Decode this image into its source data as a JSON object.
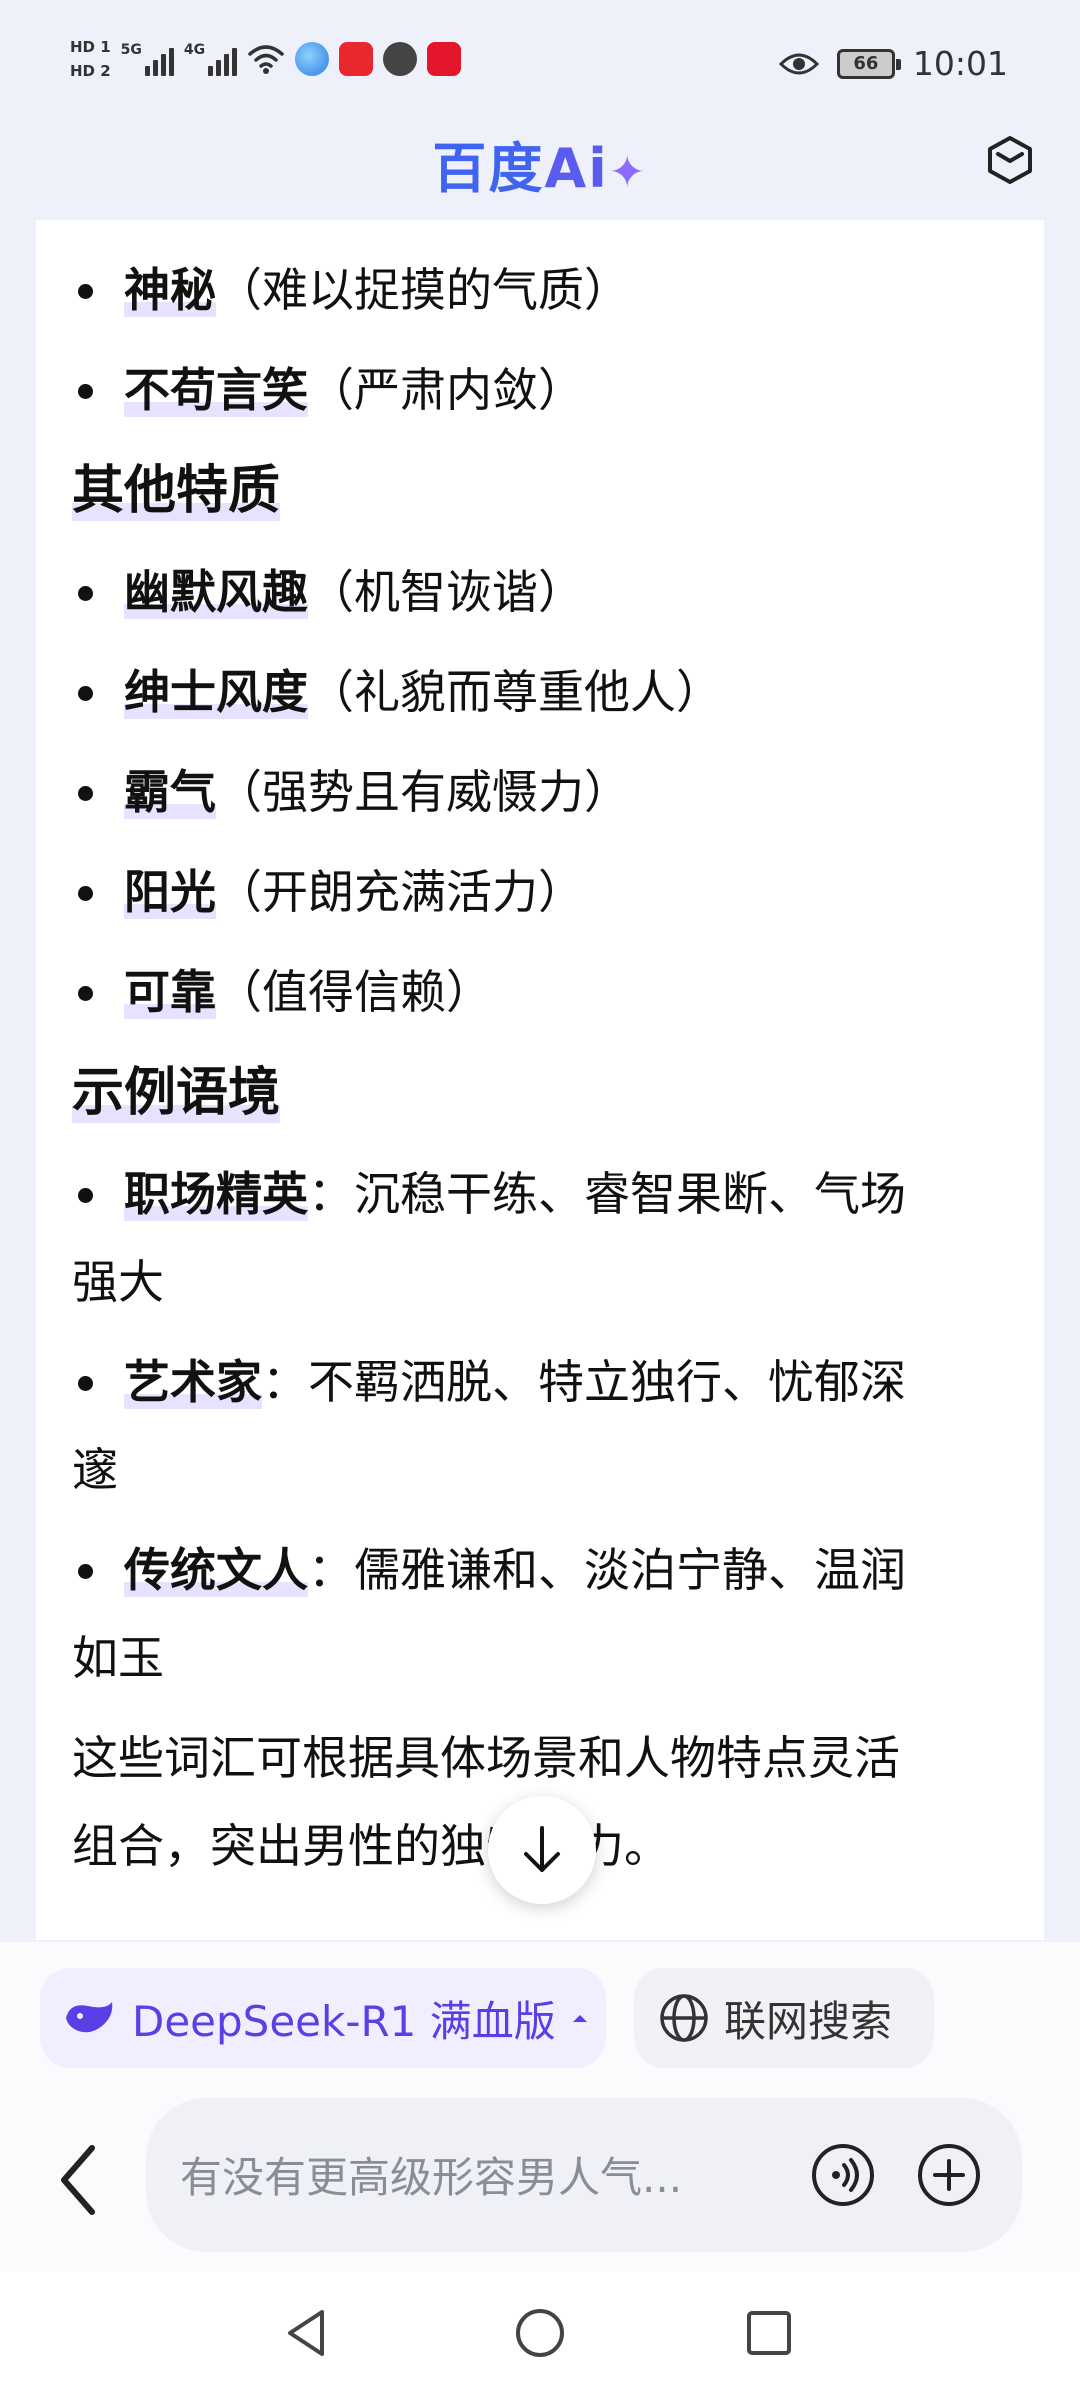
{
  "status_bar": {
    "hd1": "HD 1",
    "hd2": "HD 2",
    "net1": "5G",
    "net2": "4G",
    "battery": "66",
    "time": "10:01"
  },
  "header": {
    "logo_main": "百度",
    "logo_ai": "Ai",
    "logo_spark": "✦"
  },
  "content": {
    "items_top": [
      {
        "keyword": "神秘",
        "desc": "（难以捉摸的气质）"
      },
      {
        "keyword": "不苟言笑",
        "desc": "（严肃内敛）"
      }
    ],
    "section_other": "其他特质",
    "items_other": [
      {
        "keyword": "幽默风趣",
        "desc": "（机智诙谐）"
      },
      {
        "keyword": "绅士风度",
        "desc": "（礼貌而尊重他人）"
      },
      {
        "keyword": "霸气",
        "desc": "（强势且有威慑力）"
      },
      {
        "keyword": "阳光",
        "desc": "（开朗充满活力）"
      },
      {
        "keyword": "可靠",
        "desc": "（值得信赖）"
      }
    ],
    "section_example": "示例语境",
    "examples": [
      {
        "keyword": "职场精英",
        "line1": "：沉稳干练、睿智果断、气场",
        "line2": "强大"
      },
      {
        "keyword": "艺术家",
        "line1": "：不羁洒脱、特立独行、忧郁深",
        "line2": "邃"
      },
      {
        "keyword": "传统文人",
        "line1": "：儒雅谦和、淡泊宁静、温润",
        "line2": "如玉"
      }
    ],
    "summary_line1": "这些词汇可根据具体场景和人物特点灵活",
    "summary_line2": "组合，突出男性的独特魅力。"
  },
  "bottom": {
    "model_label": "DeepSeek-R1 满血版",
    "search_label": "联网搜索",
    "input_placeholder": "有没有更高级形容男人气..."
  },
  "colors": {
    "brand_blue": "#3f64f0",
    "accent_purple": "#5b3ee6",
    "highlight": "#e7e2ff"
  }
}
